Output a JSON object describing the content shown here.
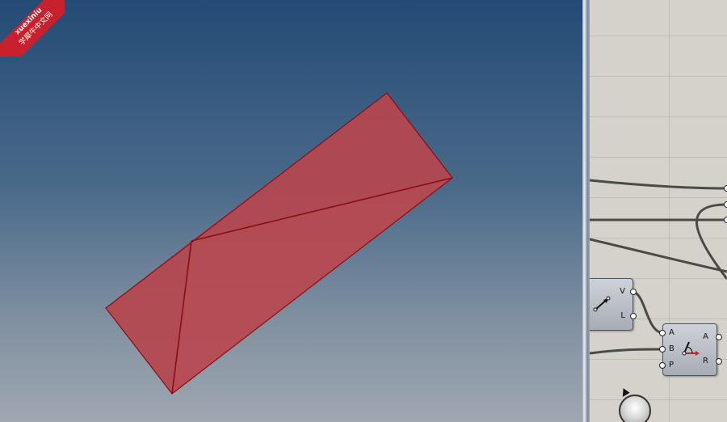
{
  "watermark": {
    "line1": "xuexiniu",
    "line2": "学犀牛中文网"
  },
  "components": {
    "vector": {
      "outputs": [
        "V",
        "L"
      ]
    },
    "angle": {
      "inputs": [
        "A",
        "B",
        "P"
      ],
      "outputs": [
        "A",
        "R"
      ]
    }
  },
  "colors": {
    "surface": "#b5474f",
    "edge": "#8a0d14",
    "wire": "#4a4a46"
  }
}
